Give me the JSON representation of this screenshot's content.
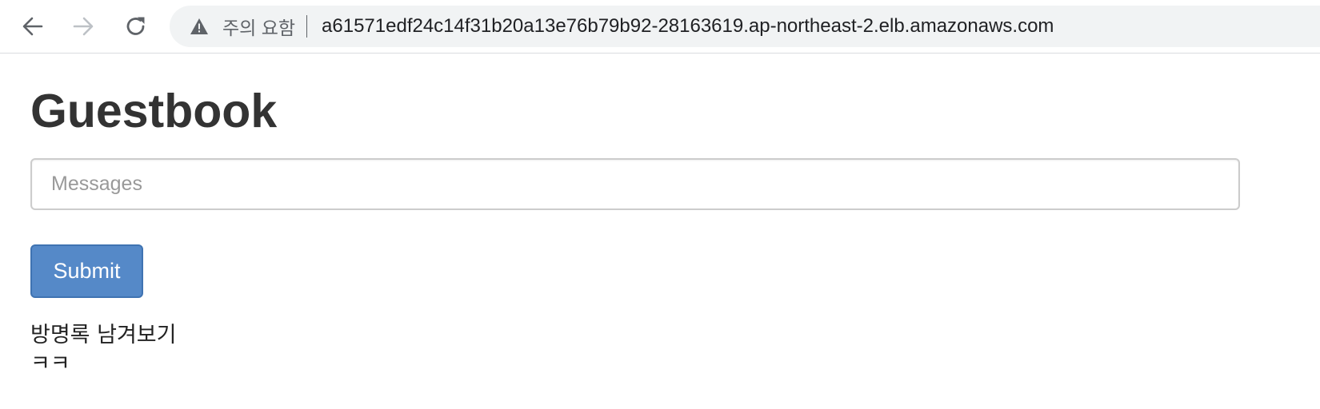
{
  "browser": {
    "security_label": "주의 요함",
    "url": "a61571edf24c14f31b20a13e76b79b92-28163619.ap-northeast-2.elb.amazonaws.com",
    "icons": {
      "back": "arrow-left-icon",
      "forward": "arrow-right-icon",
      "reload": "reload-icon",
      "warning": "warning-triangle-icon"
    }
  },
  "page": {
    "title": "Guestbook",
    "message_input": {
      "placeholder": "Messages",
      "value": ""
    },
    "submit_label": "Submit",
    "entries": [
      "방명록 남겨보기",
      "ㅋㅋ"
    ]
  },
  "colors": {
    "primary_button": "#5589c8",
    "primary_button_border": "#3f73b2",
    "text": "#333333"
  }
}
